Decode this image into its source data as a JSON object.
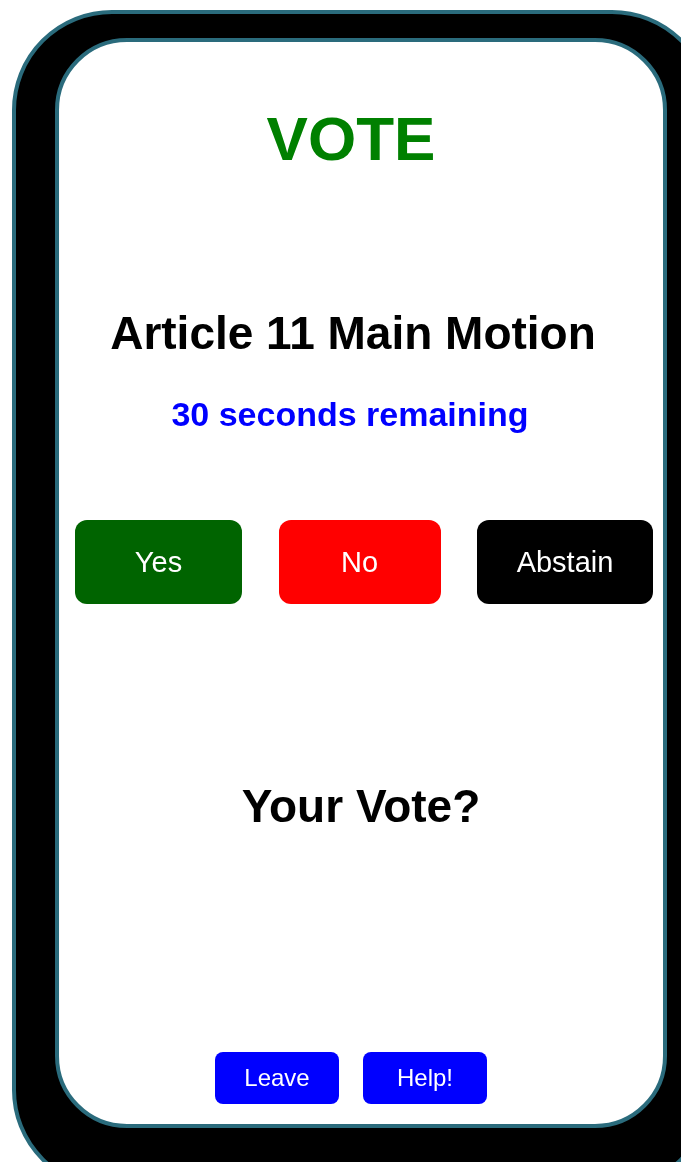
{
  "header": "VOTE",
  "motion": "Article 11 Main Motion",
  "timer": "30 seconds remaining",
  "options": [
    {
      "label": "Yes",
      "color": "#006400"
    },
    {
      "label": "No",
      "color": "#ff0000"
    },
    {
      "label": "Abstain",
      "color": "#000000"
    }
  ],
  "prompt": "Your Vote?",
  "actions": [
    "Leave",
    "Help!"
  ]
}
